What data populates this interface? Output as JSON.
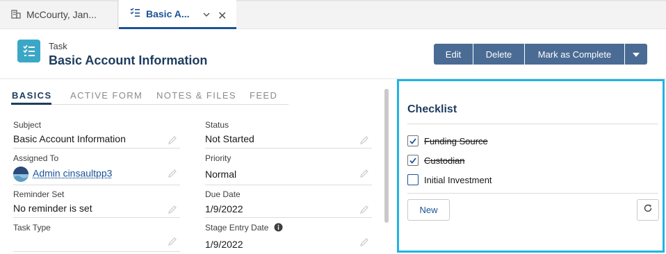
{
  "tabs": [
    {
      "label": "McCourty, Jan...",
      "icon": "building-icon"
    },
    {
      "label": "Basic A...",
      "icon": "checklist-icon"
    }
  ],
  "header": {
    "object_type": "Task",
    "title": "Basic Account Information",
    "buttons": {
      "edit": "Edit",
      "delete": "Delete",
      "mark_complete": "Mark as Complete"
    }
  },
  "subtabs": [
    "BASICS",
    "ACTIVE FORM",
    "NOTES & FILES",
    "FEED"
  ],
  "fields": {
    "subject": {
      "label": "Subject",
      "value": "Basic Account Information"
    },
    "assigned_to": {
      "label": "Assigned To",
      "value": "Admin cinsaultpp3"
    },
    "reminder_set": {
      "label": "Reminder Set",
      "value": "No reminder is set"
    },
    "task_type": {
      "label": "Task Type",
      "value": ""
    },
    "status": {
      "label": "Status",
      "value": "Not Started"
    },
    "priority": {
      "label": "Priority",
      "value": "Normal"
    },
    "due_date": {
      "label": "Due Date",
      "value": "1/9/2022"
    },
    "stage_entry_date": {
      "label": "Stage Entry Date",
      "value": "1/9/2022"
    }
  },
  "checklist": {
    "title": "Checklist",
    "items": [
      {
        "label": "Funding Source",
        "checked": true
      },
      {
        "label": "Custodian",
        "checked": true
      },
      {
        "label": "Initial Investment",
        "checked": false
      }
    ],
    "new_label": "New"
  },
  "colors": {
    "accent": "#1b5297",
    "button": "#4a6b94",
    "panel_border": "#1fb3e5",
    "task_icon": "#3ba7c6"
  }
}
